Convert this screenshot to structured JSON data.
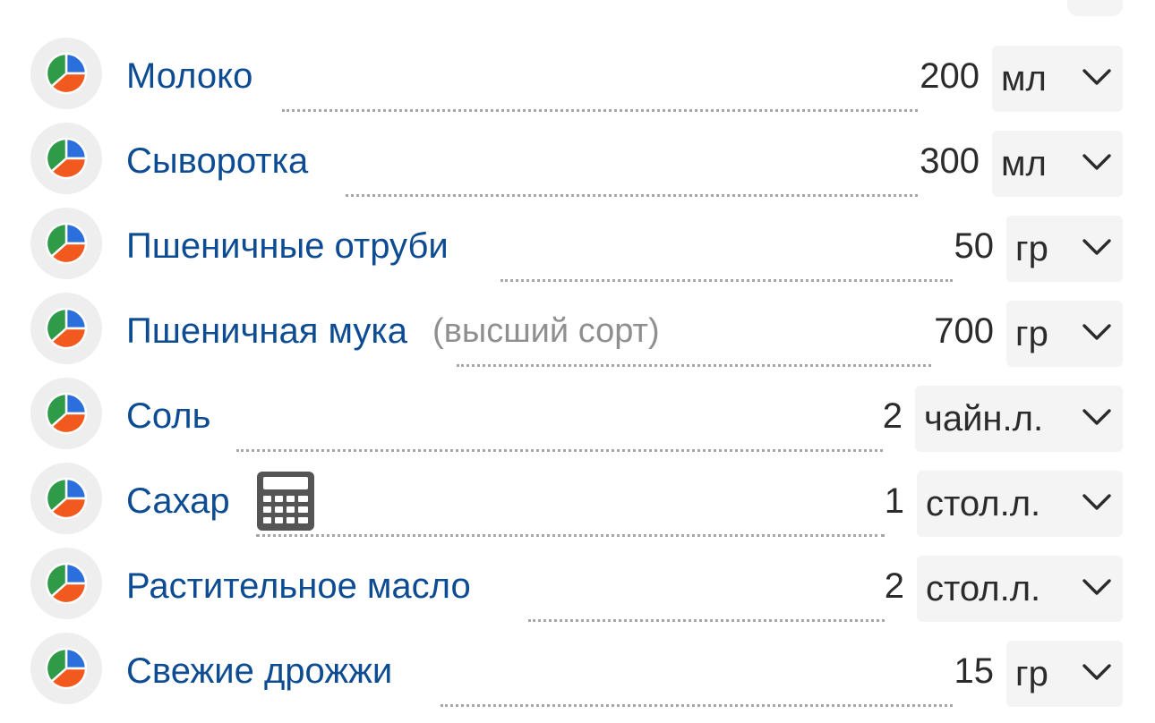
{
  "ingredients": [
    {
      "name": "Молоко",
      "note": "",
      "calculator": false,
      "quantity": "200",
      "unit": "мл"
    },
    {
      "name": "Сыворотка",
      "note": "",
      "calculator": false,
      "quantity": "300",
      "unit": "мл"
    },
    {
      "name": "Пшеничные отруби",
      "note": "",
      "calculator": false,
      "quantity": "50",
      "unit": "гр"
    },
    {
      "name": "Пшеничная мука",
      "note": "(высший сорт)",
      "calculator": false,
      "quantity": "700",
      "unit": "гр"
    },
    {
      "name": "Соль",
      "note": "",
      "calculator": false,
      "quantity": "2",
      "unit": "чайн.л."
    },
    {
      "name": "Сахар",
      "note": "",
      "calculator": true,
      "quantity": "1",
      "unit": "стол.л."
    },
    {
      "name": "Растительное масло",
      "note": "",
      "calculator": false,
      "quantity": "2",
      "unit": "стол.л."
    },
    {
      "name": "Свежие дрожжи",
      "note": "",
      "calculator": false,
      "quantity": "15",
      "unit": "гр"
    }
  ],
  "icons": {
    "nutrition": "pie-chart-icon",
    "calculator": "calculator-icon",
    "dropdown": "chevron-down-icon"
  },
  "colors": {
    "name_text": "#0d4c92",
    "note_text": "#8f8f8f",
    "pie_blue": "#2a6fdb",
    "pie_green": "#2f9a48",
    "pie_orange": "#f2591e",
    "select_bg": "#f4f4f4",
    "icon_bg": "#eeeeee"
  }
}
